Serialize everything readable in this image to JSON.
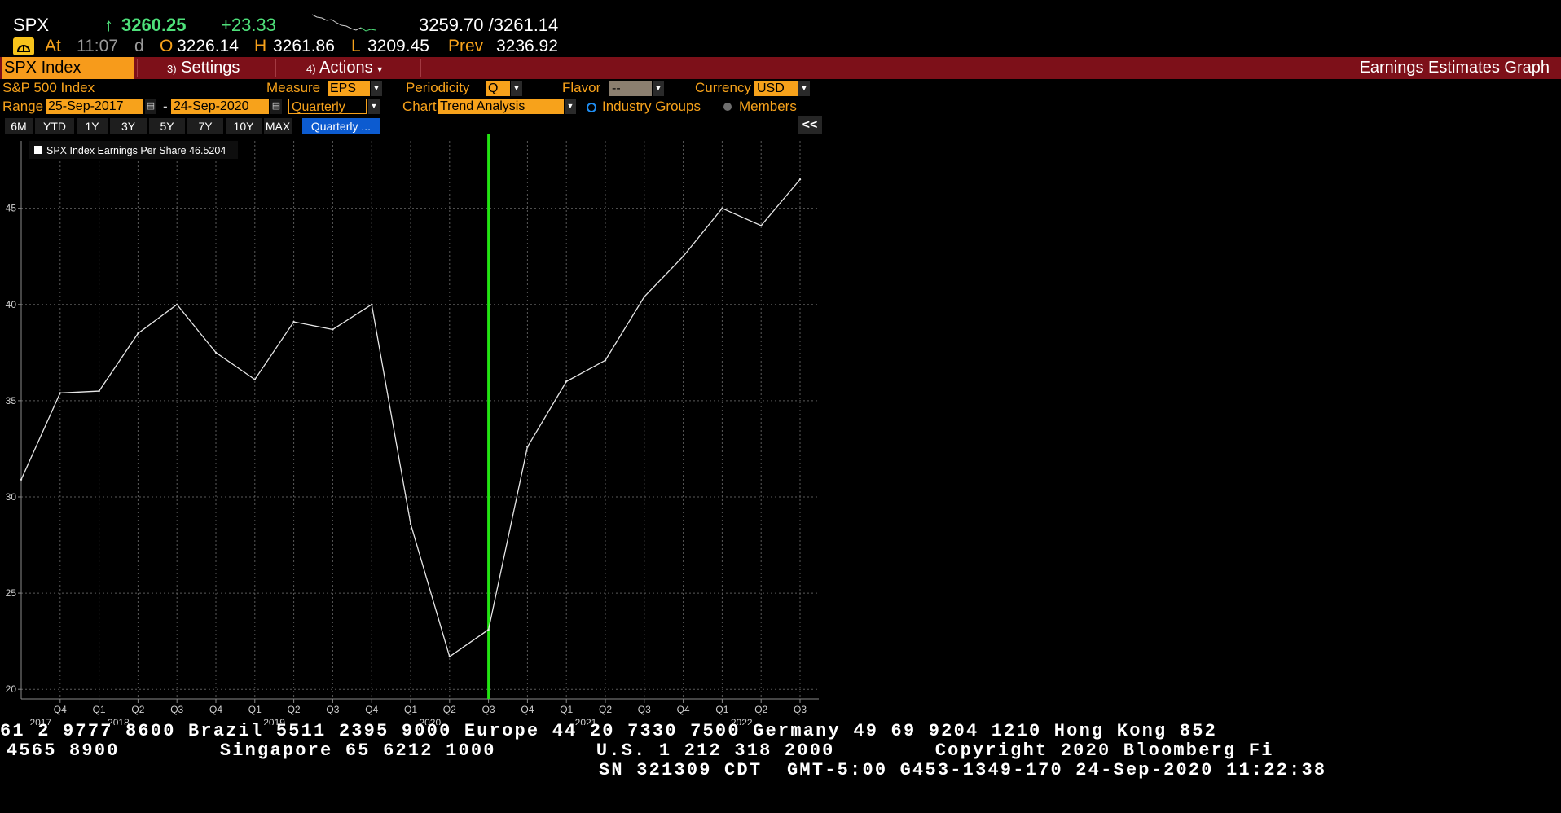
{
  "quote": {
    "ticker": "SPX",
    "arrow": "↑",
    "last": "3260.25",
    "change": "+23.33",
    "bid_ask": "3259.70 /3261.14",
    "at_label": "At",
    "time": "11:07",
    "time_flag": "d",
    "open_label": "O",
    "open": "3226.14",
    "high_label": "H",
    "high": "3261.86",
    "low_label": "L",
    "low": "3209.45",
    "prev_label": "Prev",
    "prev": "3236.92",
    "sparkline": [
      0.0,
      0.15,
      0.2,
      0.35,
      0.3,
      0.5,
      0.65,
      0.7,
      0.85,
      0.95,
      0.8,
      1.0,
      0.9,
      0.95
    ]
  },
  "menubar": {
    "security": "SPX Index",
    "settings_num": "3)",
    "settings": "Settings",
    "actions_num": "4)",
    "actions": "Actions",
    "actions_caret": "▾",
    "title": "Earnings Estimates Graph"
  },
  "controls": {
    "security_name": "S&P 500 Index",
    "measure_label": "Measure",
    "measure_value": "EPS",
    "periodicity_label": "Periodicity",
    "periodicity_value": "Q",
    "flavor_label": "Flavor",
    "flavor_value": "--",
    "currency_label": "Currency",
    "currency_value": "USD",
    "range_label": "Range",
    "range_start": "25-Sep-2017",
    "range_dash": "-",
    "range_end": "24-Sep-2020",
    "range_period": "Quarterly",
    "chart_label": "Chart",
    "chart_value": "Trend Analysis",
    "industry_groups": "Industry Groups",
    "members": "Members"
  },
  "range_buttons": [
    "6M",
    "YTD",
    "1Y",
    "3Y",
    "5Y",
    "7Y",
    "10Y",
    "MAX"
  ],
  "range_selected": "Quarterly ...",
  "collapse_label": "<<",
  "chart_data": {
    "type": "line",
    "legend": "SPX Index Earnings Per Share 46.5204",
    "series": [
      {
        "name": "SPX Index Earnings Per Share",
        "color": "#e6e6e6",
        "x": [
          "2017 Q3",
          "2017 Q4",
          "2018 Q1",
          "2018 Q2",
          "2018 Q3",
          "2018 Q4",
          "2019 Q1",
          "2019 Q2",
          "2019 Q3",
          "2019 Q4",
          "2020 Q1",
          "2020 Q2",
          "2020 Q3",
          "2020 Q4",
          "2021 Q1",
          "2021 Q2",
          "2021 Q3",
          "2021 Q4",
          "2022 Q1",
          "2022 Q2",
          "2022 Q3"
        ],
        "values": [
          30.9,
          35.4,
          35.5,
          38.5,
          40.0,
          37.5,
          36.1,
          39.1,
          38.7,
          40.0,
          28.6,
          21.7,
          23.1,
          32.6,
          36.0,
          37.1,
          40.4,
          42.5,
          45.0,
          44.1,
          46.5
        ]
      }
    ],
    "ylim": [
      19.5,
      48.5
    ],
    "yticks": [
      20,
      25,
      30,
      35,
      40,
      45
    ],
    "quarter_labels": [
      "Q4",
      "Q1",
      "Q2",
      "Q3",
      "Q4",
      "Q1",
      "Q2",
      "Q3",
      "Q4",
      "Q1",
      "Q2",
      "Q3",
      "Q4",
      "Q1",
      "Q2",
      "Q3",
      "Q4",
      "Q1",
      "Q2",
      "Q3"
    ],
    "year_labels": [
      {
        "label": "2017",
        "at_quarter": 0
      },
      {
        "label": "2018",
        "at_quarter": 2
      },
      {
        "label": "2019",
        "at_quarter": 6
      },
      {
        "label": "2020",
        "at_quarter": 10
      },
      {
        "label": "2021",
        "at_quarter": 14
      },
      {
        "label": "2022",
        "at_quarter": 18
      }
    ],
    "current_marker": "2020 Q3",
    "marker_color": "#22e312",
    "grid": true
  },
  "ticker_tape": {
    "line1": "61 2 9777 8600 Brazil 5511 2395 9000 Europe 44 20 7330 7500 Germany 49 69 9204 1210 Hong Kong 852",
    "line2": "4565 8900        Singapore 65 6212 1000        U.S. 1 212 318 2000        Copyright 2020 Bloomberg Fi",
    "line3": "SN 321309 CDT  GMT-5:00 G453-1349-170 24-Sep-2020 11:22:38"
  }
}
